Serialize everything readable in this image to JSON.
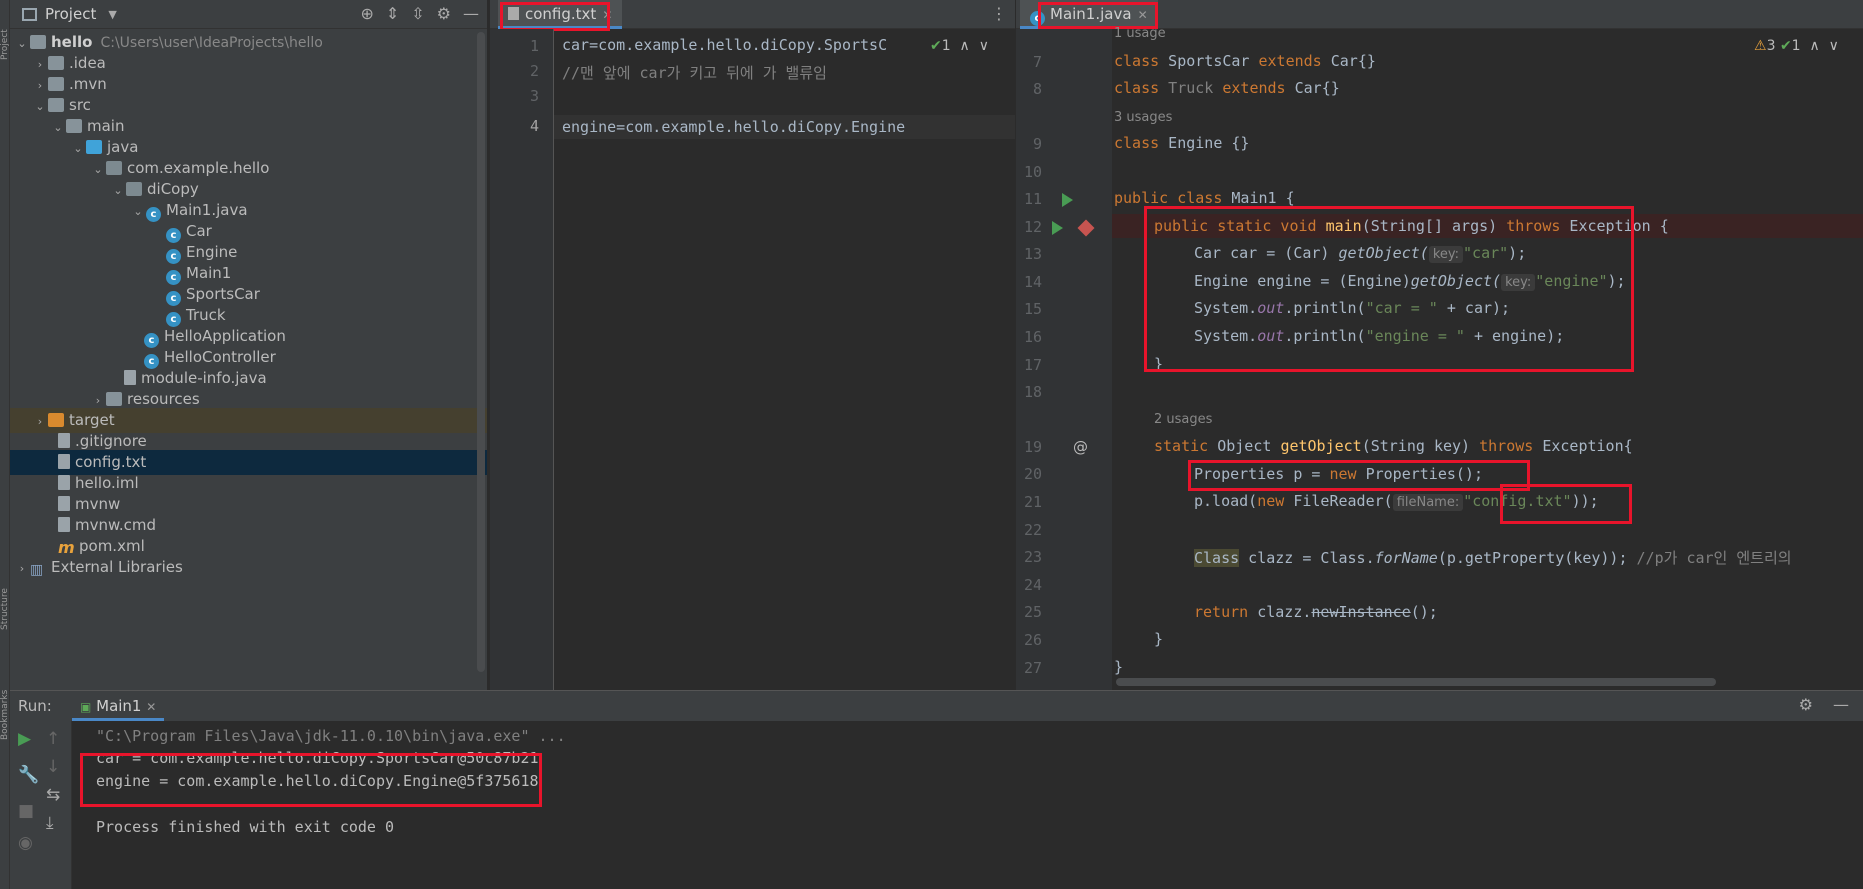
{
  "project_panel": {
    "title": "Project",
    "tree": [
      {
        "label": "hello",
        "extra": "C:\\Users\\user\\IdeaProjects\\hello"
      },
      {
        "label": ".idea"
      },
      {
        "label": ".mvn"
      },
      {
        "label": "src"
      },
      {
        "label": "main"
      },
      {
        "label": "java"
      },
      {
        "label": "com.example.hello"
      },
      {
        "label": "diCopy"
      },
      {
        "label": "Main1.java"
      },
      {
        "label": "Car"
      },
      {
        "label": "Engine"
      },
      {
        "label": "Main1"
      },
      {
        "label": "SportsCar"
      },
      {
        "label": "Truck"
      },
      {
        "label": "HelloApplication"
      },
      {
        "label": "HelloController"
      },
      {
        "label": "module-info.java"
      },
      {
        "label": "resources"
      },
      {
        "label": "target"
      },
      {
        "label": ".gitignore"
      },
      {
        "label": "config.txt"
      },
      {
        "label": "hello.iml"
      },
      {
        "label": "mvnw"
      },
      {
        "label": "mvnw.cmd"
      },
      {
        "label": "pom.xml"
      },
      {
        "label": "External Libraries"
      }
    ]
  },
  "config_editor": {
    "tab": "config.txt",
    "lines": [
      {
        "num": "1",
        "text": "car=com.example.hello.diCopy.SportsC"
      },
      {
        "num": "2",
        "text": "//맨 앞에 car가 키고 뒤에 가 밸류임"
      },
      {
        "num": "3",
        "text": ""
      },
      {
        "num": "4",
        "text": "engine=com.example.hello.diCopy.Engine"
      }
    ],
    "inspection": "1"
  },
  "main_editor": {
    "tab": "Main1.java",
    "inspection_warn": "3",
    "inspection_ok": "1",
    "hints": {
      "usage1": "1 usage",
      "usage3": "3 usages",
      "usage2": "2 usages"
    },
    "param_hints": {
      "key": "key:",
      "fileName": "fileName:"
    },
    "lines": {
      "l7": {
        "num": "7",
        "kw": "class",
        "name": " SportsCar ",
        "kw2": "extends",
        "rest": " Car{}"
      },
      "l8": {
        "num": "8",
        "kw": "class",
        "name": " Truck ",
        "kw2": "extends",
        "rest": " Car{}"
      },
      "l9": {
        "num": "9",
        "kw": "class",
        "rest": " Engine {}"
      },
      "l10": {
        "num": "10"
      },
      "l11": {
        "num": "11",
        "kw": "public class",
        "rest": " Main1 {"
      },
      "l12": {
        "num": "12",
        "kw": "public static void",
        "fn": " main",
        "rest": "(String[] args) ",
        "kw2": "throws",
        "rest2": " Exception {"
      },
      "l13": {
        "num": "13",
        "a": "Car car = (Car) ",
        "fn": "getObject(",
        "str": "\"car\"",
        "b": ");"
      },
      "l14": {
        "num": "14",
        "a": "Engine engine = (Engine)",
        "fn": "getObject(",
        "str": "\"engine\"",
        "b": ");"
      },
      "l15": {
        "num": "15",
        "a": "System.",
        "out": "out",
        "b": ".println(",
        "str": "\"car = \"",
        "c": " + car);"
      },
      "l16": {
        "num": "16",
        "a": "System.",
        "out": "out",
        "b": ".println(",
        "str": "\"engine = \"",
        "c": " + engine);"
      },
      "l17": {
        "num": "17",
        "rest": "}"
      },
      "l18": {
        "num": "18"
      },
      "l19": {
        "num": "19",
        "kw": "static",
        "a": " Object ",
        "fn": "getObject",
        "b": "(String key) ",
        "kw2": "throws",
        "c": " Exception{"
      },
      "l20": {
        "num": "20",
        "a": "Properties p = ",
        "kw": "new",
        "b": " Properties();"
      },
      "l21": {
        "num": "21",
        "a": "p.load(",
        "kw": "new",
        "b": " FileReader(",
        "str": "\"config.txt\"",
        "c": "));"
      },
      "l22": {
        "num": "22"
      },
      "l23": {
        "num": "23",
        "cls": "Class",
        "a": " clazz = Class.",
        "fn": "forName",
        "b": "(p.getProperty(key)); ",
        "cm": "//p가 car인 엔트리의"
      },
      "l24": {
        "num": "24"
      },
      "l25": {
        "num": "25",
        "kw": "return",
        "a": " clazz.",
        "fn": "newInstance",
        "b": "();"
      },
      "l26": {
        "num": "26",
        "rest": "}"
      },
      "l27": {
        "num": "27",
        "rest": "}"
      }
    }
  },
  "run_panel": {
    "label": "Run:",
    "tab": "Main1",
    "cmd": "\"C:\\Program Files\\Java\\jdk-11.0.10\\bin\\java.exe\" ...",
    "out1": "car = com.example.hello.diCopy.SportsCar@50c87b21",
    "out2": "engine = com.example.hello.diCopy.Engine@5f375618",
    "exit": "Process finished with exit code 0"
  },
  "side_labels": {
    "project": "Project",
    "structure": "Structure",
    "bookmarks": "Bookmarks"
  },
  "colors": {
    "highlight_box": "#e8142b",
    "keyword": "#cc7832",
    "string": "#6a8759",
    "function": "#ffc66d"
  }
}
